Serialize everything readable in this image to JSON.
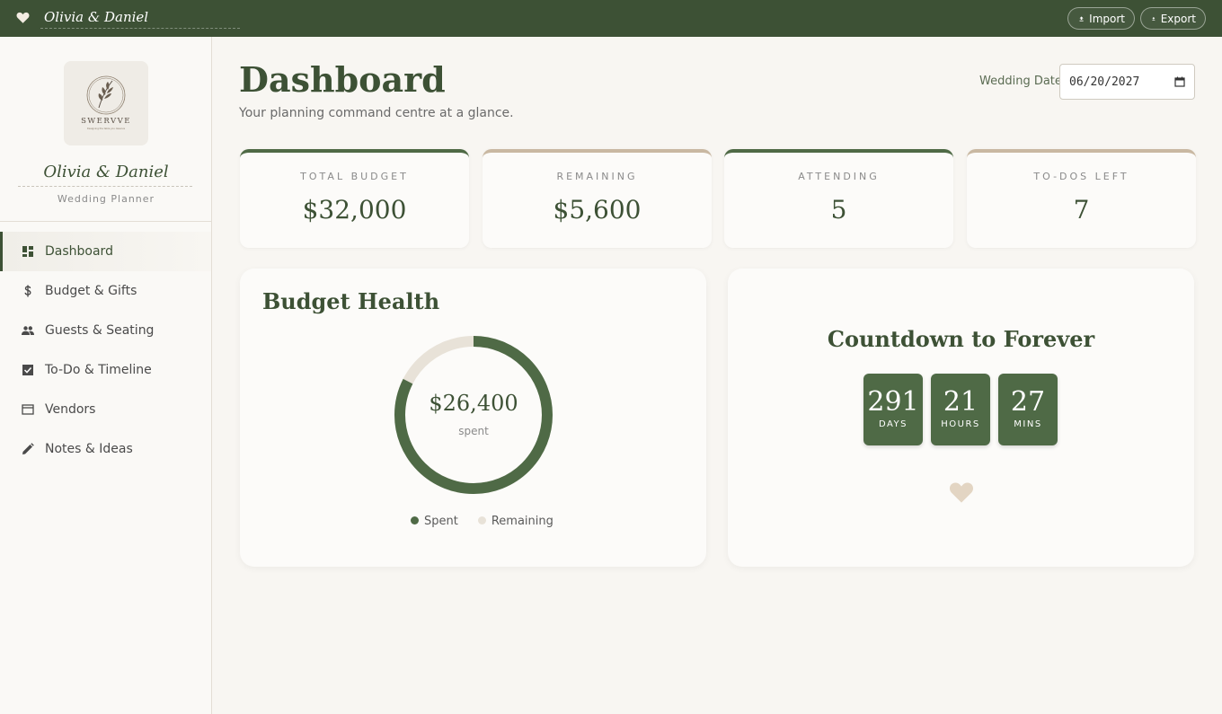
{
  "topbar": {
    "couple_name": "Olivia & Daniel",
    "import_label": "Import",
    "export_label": "Export"
  },
  "sidebar": {
    "logo_text": "SWERVVE",
    "logo_tagline": "Designing the table you deserve",
    "couple_name": "Olivia & Daniel",
    "role": "Wedding Planner",
    "items": [
      {
        "label": "Dashboard",
        "icon": "dashboard-icon",
        "active": true
      },
      {
        "label": "Budget & Gifts",
        "icon": "dollar-icon",
        "active": false
      },
      {
        "label": "Guests & Seating",
        "icon": "people-icon",
        "active": false
      },
      {
        "label": "To-Do & Timeline",
        "icon": "checkbox-icon",
        "active": false
      },
      {
        "label": "Vendors",
        "icon": "store-icon",
        "active": false
      },
      {
        "label": "Notes & Ideas",
        "icon": "pencil-icon",
        "active": false
      }
    ]
  },
  "header": {
    "title": "Dashboard",
    "subtitle": "Your planning command centre at a glance.",
    "wedding_date_label": "Wedding Date",
    "wedding_date_value": "06/20/2027"
  },
  "stats": [
    {
      "label": "TOTAL BUDGET",
      "value": "$32,000"
    },
    {
      "label": "REMAINING",
      "value": "$5,600"
    },
    {
      "label": "ATTENDING",
      "value": "5"
    },
    {
      "label": "TO-DOS LEFT",
      "value": "7"
    }
  ],
  "budget_health": {
    "title": "Budget Health",
    "spent_amount": "$26,400",
    "spent_caption": "spent",
    "spent_fraction": 0.825,
    "legend_spent": "Spent",
    "legend_remaining": "Remaining"
  },
  "countdown": {
    "title": "Countdown to Forever",
    "days": "291",
    "days_label": "DAYS",
    "hours": "21",
    "hours_label": "HOURS",
    "mins": "27",
    "mins_label": "MINS"
  },
  "colors": {
    "primary": "#3d5135",
    "accent": "#4f6a46",
    "tan": "#c9b8a2",
    "track": "#e8e2d8"
  }
}
